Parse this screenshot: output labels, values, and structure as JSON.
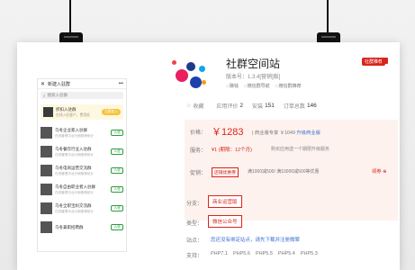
{
  "phone": {
    "header_title": "新建入驻群",
    "search_placeholder": "搜索入驻群",
    "featured": {
      "title": "折扣入驻群",
      "subtitle": "在线入驻客户，费用低",
      "button": "立即加入"
    },
    "items": [
      {
        "title": "乌冬企业家入驻群",
        "subtitle": "在线管理平台分销推荐统计",
        "button": "入驻"
      },
      {
        "title": "乌冬餐饮行业入驻群",
        "subtitle": "在线管理平台分销推荐统计",
        "button": "入驻"
      },
      {
        "title": "乌冬电商运营交流群",
        "subtitle": "在线管理平台分销推荐统计",
        "button": "入驻"
      },
      {
        "title": "乌冬自由职业者入驻群",
        "subtitle": "在线管理平台分销推荐统计",
        "button": "入驻"
      },
      {
        "title": "乌冬全职宝妈交流群",
        "subtitle": "在线管理平台分销推荐统计",
        "button": "入驻"
      },
      {
        "title": "乌冬兼职招聘群",
        "subtitle": "",
        "button": "入驻"
      }
    ]
  },
  "product": {
    "title": "社群空间站",
    "version": "版本号：1.3.4[营销]版]",
    "tags": [
      "赚钱",
      "微信群导航",
      "微信群推荐"
    ],
    "badge": "社群推荐",
    "stats": {
      "fav_label": "收藏",
      "rating_label": "应用评价",
      "rating": "2",
      "install_label": "安装",
      "install": "151",
      "order_label": "订单总数",
      "order": "146"
    }
  },
  "pricing": {
    "price_label": "价格：",
    "price": "￥1283",
    "price_note": "| 商业版专享 ￥1049",
    "upgrade": "升级商业版",
    "service_label": "服务：",
    "service": "¥1 (期限：12个月)",
    "service_note": "购买应用送一个期限升级服务",
    "promo_label": "促销：",
    "promo_tag": "店铺优惠券",
    "promo_text": "满1000减500/ 满10000减500等优惠",
    "coupon": "领券 ⊕"
  },
  "options": {
    "variant_label": "分支：",
    "variant": "商业运营版",
    "type_label": "类型：",
    "type": "微信公众号",
    "site_label": "站点：",
    "site_link": "您还没有绑定站点，请先下载并注册微擎",
    "support_label": "支持：",
    "php": [
      "PHP7.1",
      "PHP5.6",
      "PHP5.5",
      "PHP5.4",
      "PHP5.3"
    ]
  }
}
